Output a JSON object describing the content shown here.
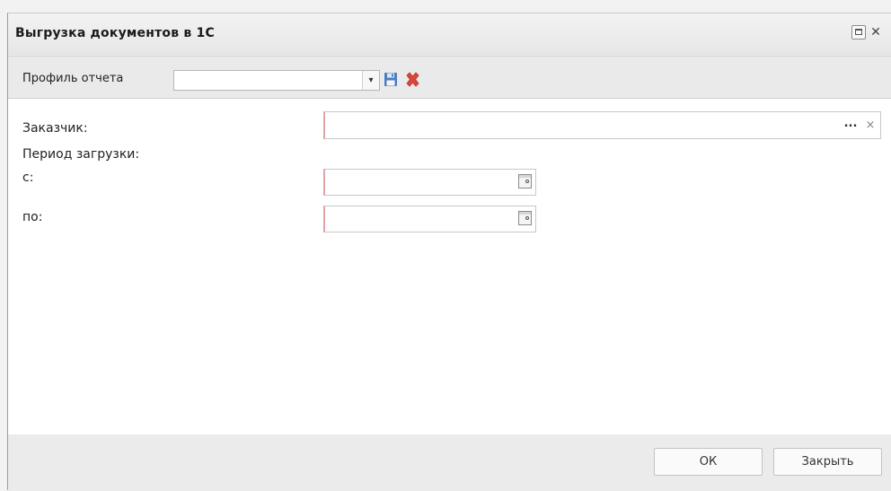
{
  "window": {
    "title": "Выгрузка документов в 1С",
    "close_glyph": "✕"
  },
  "toolbar": {
    "profile_label": "Профиль отчета",
    "profile_value": "",
    "dropdown_glyph": "▾",
    "save_icon": "save-icon",
    "delete_icon": "delete-icon",
    "save_color": "#4a7fc1",
    "delete_color": "#d9473a"
  },
  "form": {
    "customer_label": "Заказчик:",
    "customer_value": "",
    "customer_select_glyph": "...",
    "customer_clear_glyph": "×",
    "period_label": "Период загрузки:",
    "from_label": "с:",
    "from_value": "",
    "to_label": "по:",
    "to_value": ""
  },
  "footer": {
    "ok_label": "ОК",
    "close_label": "Закрыть"
  },
  "colors": {
    "required_border": "#e0a4a4",
    "window_bg": "#ebebeb"
  }
}
